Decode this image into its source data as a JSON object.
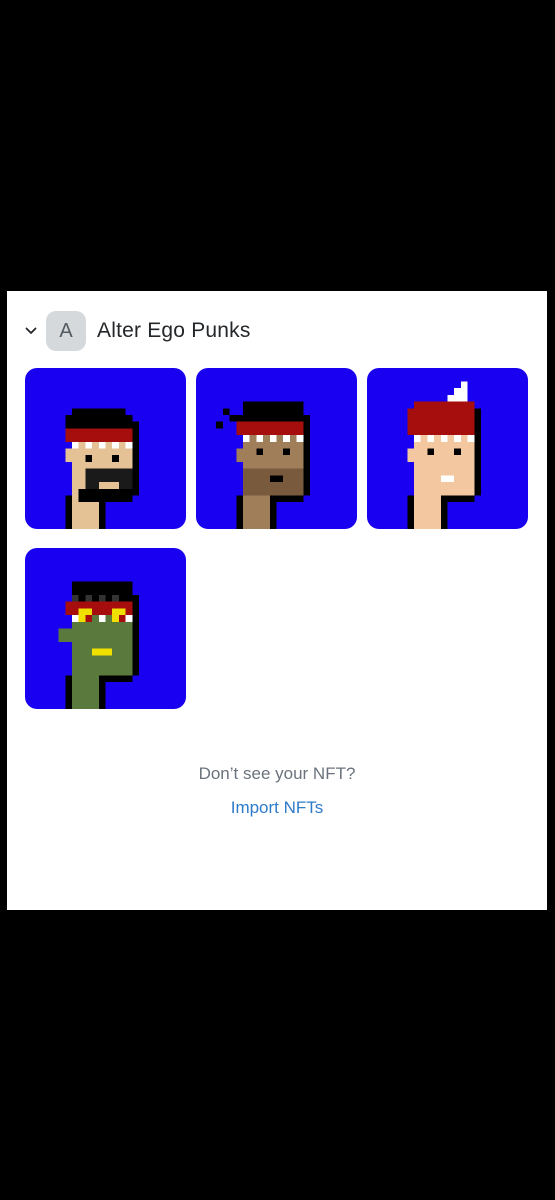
{
  "collection": {
    "expand_icon": "chevron-down-icon",
    "avatar_letter": "A",
    "name": "Alter Ego Punks"
  },
  "nfts": [
    {
      "skin": "#e5c295",
      "hair": "#000000",
      "band": "#a60e0e",
      "variant": "beard"
    },
    {
      "skin": "#a07e5a",
      "hair": "#000000",
      "band": "#a60e0e",
      "variant": "plain"
    },
    {
      "skin": "#f3c8a0",
      "hair": "#a60e0e",
      "band": "#a60e0e",
      "variant": "horn"
    },
    {
      "skin": "#5a7a3d",
      "hair": "#000000",
      "band": "#a60e0e",
      "variant": "zombie"
    }
  ],
  "footer": {
    "message": "Don’t see your NFT?",
    "import_label": "Import NFTs"
  },
  "colors": {
    "tile_background": "#1a00f0",
    "link": "#2e7bc9"
  }
}
